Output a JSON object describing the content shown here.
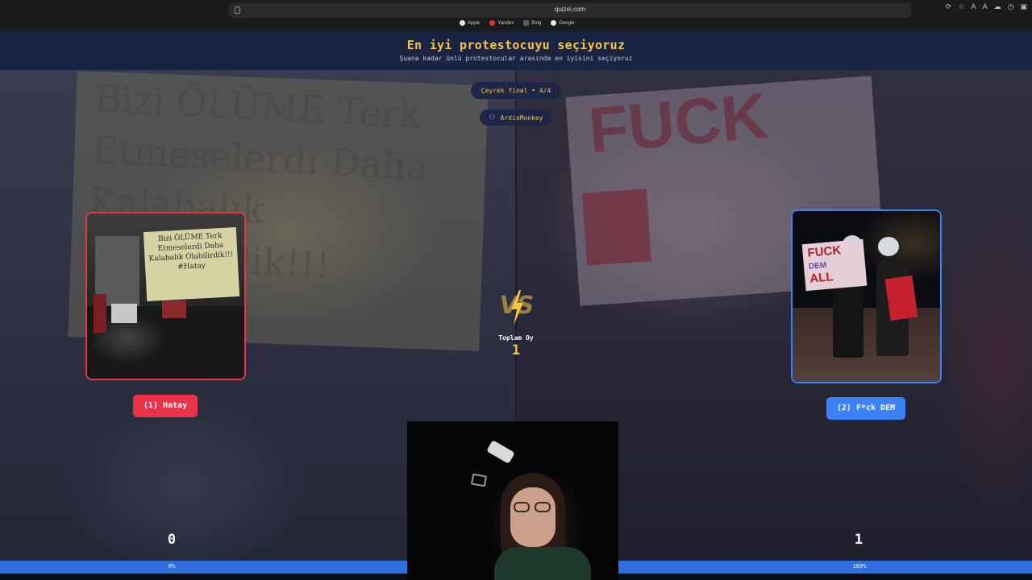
{
  "browser": {
    "url": "quizei.com",
    "bookmarks": [
      "Apple",
      "Yandex",
      "Bing",
      "Google"
    ],
    "font_size_small": "A",
    "font_size_large": "A"
  },
  "header": {
    "title": "En iyi protestocuyu seçiyoruz",
    "subtitle": "Şuana kadar ünlü protestocular arasında en iyisini seçiyoruz"
  },
  "round": {
    "label": "Çeyrek final • 4/4",
    "username": "ArdioMonkey"
  },
  "background_text": "Bizi ÖLÜME Terk Etmeselerdi Daha Kalabalık Olabilirdik!!! #Hatay",
  "left": {
    "sign_text": "Bizi ÖLÜME Terk Etmeselerdi Daha Kalabalık Olabilirdik!!! #Hatay",
    "button_label": "(1) Hatay",
    "score": "0",
    "percent_label": "0%",
    "percent": 0,
    "border_color": "#e8334a"
  },
  "right": {
    "sign_text_top": "FUCK",
    "sign_text_mid": "DEM",
    "sign_text_bottom": "ALL",
    "button_label": "(2) F*ck DEM",
    "score": "1",
    "percent_label": "100%",
    "percent": 100,
    "border_color": "#3b82f6"
  },
  "vs": {
    "text": "VS",
    "total_label": "Toplam Oy",
    "total_value": "1"
  },
  "colors": {
    "accent": "#f5c542",
    "header_bg": "#1a2342",
    "left_red": "#e8334a",
    "right_blue": "#3b82f6"
  }
}
